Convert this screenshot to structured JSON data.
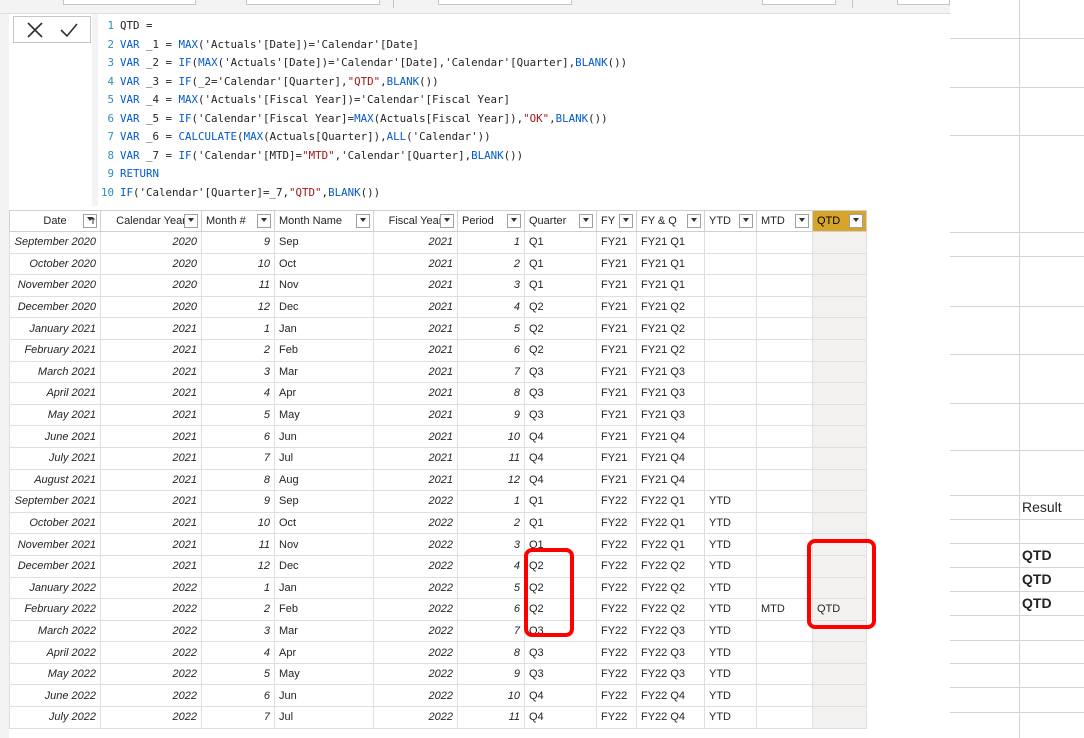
{
  "formula": {
    "lines": [
      [
        [
          "t",
          "QTD ="
        ]
      ],
      [
        [
          "k",
          "VAR"
        ],
        [
          "t",
          " _1 = "
        ],
        [
          "k",
          "MAX"
        ],
        [
          "t",
          "('Actuals'[Date])='Calendar'[Date]"
        ]
      ],
      [
        [
          "k",
          "VAR"
        ],
        [
          "t",
          " _2 = "
        ],
        [
          "k",
          "IF"
        ],
        [
          "t",
          "("
        ],
        [
          "k",
          "MAX"
        ],
        [
          "t",
          "('Actuals'[Date])='Calendar'[Date],'Calendar'[Quarter],"
        ],
        [
          "k",
          "BLANK"
        ],
        [
          "t",
          "())"
        ]
      ],
      [
        [
          "k",
          "VAR"
        ],
        [
          "t",
          " _3 = "
        ],
        [
          "k",
          "IF"
        ],
        [
          "t",
          "(_2='Calendar'[Quarter],"
        ],
        [
          "s",
          "\"QTD\""
        ],
        [
          "t",
          ","
        ],
        [
          "k",
          "BLANK"
        ],
        [
          "t",
          "())"
        ]
      ],
      [
        [
          "k",
          "VAR"
        ],
        [
          "t",
          " _4 = "
        ],
        [
          "k",
          "MAX"
        ],
        [
          "t",
          "('Actuals'[Fiscal Year])='Calendar'[Fiscal Year]"
        ]
      ],
      [
        [
          "k",
          "VAR"
        ],
        [
          "t",
          " _5 = "
        ],
        [
          "k",
          "IF"
        ],
        [
          "t",
          "('Calendar'[Fiscal Year]="
        ],
        [
          "k",
          "MAX"
        ],
        [
          "t",
          "(Actuals[Fiscal Year]),"
        ],
        [
          "s",
          "\"OK\""
        ],
        [
          "t",
          ","
        ],
        [
          "k",
          "BLANK"
        ],
        [
          "t",
          "())"
        ]
      ],
      [
        [
          "k",
          "VAR"
        ],
        [
          "t",
          " _6 = "
        ],
        [
          "k",
          "CALCULATE"
        ],
        [
          "t",
          "("
        ],
        [
          "k",
          "MAX"
        ],
        [
          "t",
          "(Actuals[Quarter]),"
        ],
        [
          "k",
          "ALL"
        ],
        [
          "t",
          "('Calendar'))"
        ]
      ],
      [
        [
          "k",
          "VAR"
        ],
        [
          "t",
          " _7 = "
        ],
        [
          "k",
          "IF"
        ],
        [
          "t",
          "('Calendar'[MTD]="
        ],
        [
          "s",
          "\"MTD\""
        ],
        [
          "t",
          ",'Calendar'[Quarter],"
        ],
        [
          "k",
          "BLANK"
        ],
        [
          "t",
          "())"
        ]
      ],
      [
        [
          "k",
          "RETURN"
        ]
      ],
      [
        [
          "k",
          "IF"
        ],
        [
          "t",
          "('Calendar'[Quarter]=_7,"
        ],
        [
          "s",
          "\"QTD\""
        ],
        [
          "t",
          ","
        ],
        [
          "k",
          "BLANK"
        ],
        [
          "t",
          "())"
        ]
      ]
    ],
    "cancel_icon": "close-icon",
    "commit_icon": "check-icon"
  },
  "table": {
    "columns": [
      "Date",
      "Calendar Year",
      "Month #",
      "Month Name",
      "Fiscal Year",
      "Period",
      "Quarter",
      "FY",
      "FY & Q",
      "YTD",
      "MTD",
      "QTD"
    ],
    "sort_icon": "sort-ascending-icon",
    "filter_icon": "chevron-down-icon",
    "rows": [
      [
        "September 2020",
        "2020",
        "9",
        "Sep",
        "2021",
        "1",
        "Q1",
        "FY21",
        "FY21 Q1",
        "",
        "",
        ""
      ],
      [
        "October 2020",
        "2020",
        "10",
        "Oct",
        "2021",
        "2",
        "Q1",
        "FY21",
        "FY21 Q1",
        "",
        "",
        ""
      ],
      [
        "November 2020",
        "2020",
        "11",
        "Nov",
        "2021",
        "3",
        "Q1",
        "FY21",
        "FY21 Q1",
        "",
        "",
        ""
      ],
      [
        "December 2020",
        "2020",
        "12",
        "Dec",
        "2021",
        "4",
        "Q2",
        "FY21",
        "FY21 Q2",
        "",
        "",
        ""
      ],
      [
        "January 2021",
        "2021",
        "1",
        "Jan",
        "2021",
        "5",
        "Q2",
        "FY21",
        "FY21 Q2",
        "",
        "",
        ""
      ],
      [
        "February 2021",
        "2021",
        "2",
        "Feb",
        "2021",
        "6",
        "Q2",
        "FY21",
        "FY21 Q2",
        "",
        "",
        ""
      ],
      [
        "March 2021",
        "2021",
        "3",
        "Mar",
        "2021",
        "7",
        "Q3",
        "FY21",
        "FY21 Q3",
        "",
        "",
        ""
      ],
      [
        "April 2021",
        "2021",
        "4",
        "Apr",
        "2021",
        "8",
        "Q3",
        "FY21",
        "FY21 Q3",
        "",
        "",
        ""
      ],
      [
        "May 2021",
        "2021",
        "5",
        "May",
        "2021",
        "9",
        "Q3",
        "FY21",
        "FY21 Q3",
        "",
        "",
        ""
      ],
      [
        "June 2021",
        "2021",
        "6",
        "Jun",
        "2021",
        "10",
        "Q4",
        "FY21",
        "FY21 Q4",
        "",
        "",
        ""
      ],
      [
        "July 2021",
        "2021",
        "7",
        "Jul",
        "2021",
        "11",
        "Q4",
        "FY21",
        "FY21 Q4",
        "",
        "",
        ""
      ],
      [
        "August 2021",
        "2021",
        "8",
        "Aug",
        "2021",
        "12",
        "Q4",
        "FY21",
        "FY21 Q4",
        "",
        "",
        ""
      ],
      [
        "September 2021",
        "2021",
        "9",
        "Sep",
        "2022",
        "1",
        "Q1",
        "FY22",
        "FY22 Q1",
        "YTD",
        "",
        ""
      ],
      [
        "October 2021",
        "2021",
        "10",
        "Oct",
        "2022",
        "2",
        "Q1",
        "FY22",
        "FY22 Q1",
        "YTD",
        "",
        ""
      ],
      [
        "November 2021",
        "2021",
        "11",
        "Nov",
        "2022",
        "3",
        "Q1",
        "FY22",
        "FY22 Q1",
        "YTD",
        "",
        ""
      ],
      [
        "December 2021",
        "2021",
        "12",
        "Dec",
        "2022",
        "4",
        "Q2",
        "FY22",
        "FY22 Q2",
        "YTD",
        "",
        ""
      ],
      [
        "January 2022",
        "2022",
        "1",
        "Jan",
        "2022",
        "5",
        "Q2",
        "FY22",
        "FY22 Q2",
        "YTD",
        "",
        ""
      ],
      [
        "February 2022",
        "2022",
        "2",
        "Feb",
        "2022",
        "6",
        "Q2",
        "FY22",
        "FY22 Q2",
        "YTD",
        "MTD",
        "QTD"
      ],
      [
        "March 2022",
        "2022",
        "3",
        "Mar",
        "2022",
        "7",
        "Q3",
        "FY22",
        "FY22 Q3",
        "YTD",
        "",
        ""
      ],
      [
        "April 2022",
        "2022",
        "4",
        "Apr",
        "2022",
        "8",
        "Q3",
        "FY22",
        "FY22 Q3",
        "YTD",
        "",
        ""
      ],
      [
        "May 2022",
        "2022",
        "5",
        "May",
        "2022",
        "9",
        "Q3",
        "FY22",
        "FY22 Q3",
        "YTD",
        "",
        ""
      ],
      [
        "June 2022",
        "2022",
        "6",
        "Jun",
        "2022",
        "10",
        "Q4",
        "FY22",
        "FY22 Q4",
        "YTD",
        "",
        ""
      ],
      [
        "July 2022",
        "2022",
        "7",
        "Jul",
        "2022",
        "11",
        "Q4",
        "FY22",
        "FY22 Q4",
        "YTD",
        "",
        ""
      ]
    ]
  },
  "excel": {
    "header": "Result",
    "values": [
      "QTD",
      "QTD",
      "QTD"
    ]
  },
  "colors": {
    "active_column_header": "#d7a529",
    "highlight": "#ff0000",
    "keyword": "#035aca",
    "string": "#a31515",
    "line_number": "#2b91af"
  }
}
